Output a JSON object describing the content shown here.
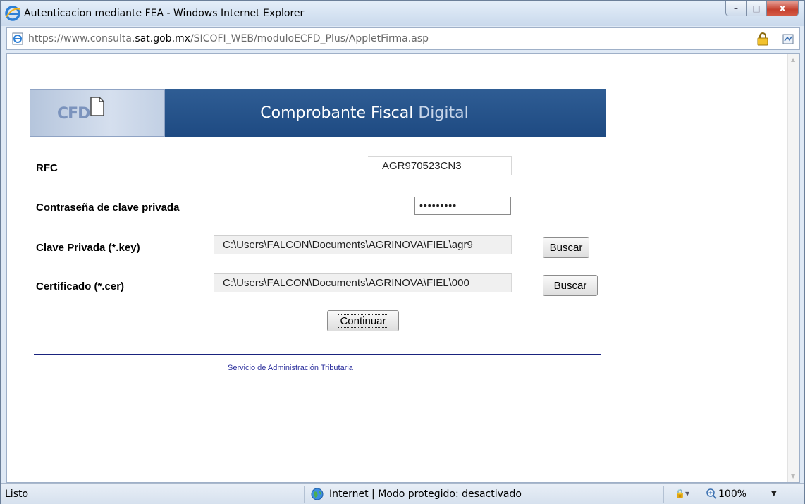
{
  "window": {
    "title": "Autenticacion mediante FEA - Windows Internet Explorer",
    "minimize_label": "–",
    "maximize_label": "□",
    "close_label": "x"
  },
  "address": {
    "url_scheme": "https://www.consulta.",
    "url_domain": "sat.gob.mx",
    "url_path": "/SICOFI_WEB/moduloECFD_Plus/AppletFirma.asp"
  },
  "banner": {
    "logo_text": "CFD",
    "title_main": "Comprobante Fiscal ",
    "title_accent": "Digital"
  },
  "form": {
    "rfc_label": "RFC",
    "rfc_value": "AGR970523CN3",
    "password_label": "Contraseña de clave privada",
    "password_value": "•••••••••",
    "key_label": "Clave Privada (*.key)",
    "key_value": "C:\\Users\\FALCON\\Documents\\AGRINOVA\\FIEL\\agr9",
    "key_button": "Buscar",
    "cert_label": "Certificado (*.cer)",
    "cert_value": "C:\\Users\\FALCON\\Documents\\AGRINOVA\\FIEL\\000",
    "cert_button": "Buscar",
    "continue_button": "Continuar"
  },
  "footer": {
    "text": "Servicio de Administración Tributaria"
  },
  "status": {
    "left_text": "Listo",
    "zone_text": "Internet | Modo protegido: desactivado",
    "zoom_text": "100%"
  },
  "colors": {
    "banner_blue": "#1e4a82",
    "rule_navy": "#1a237e",
    "footer_link": "#2b2f9c",
    "close_red": "#c5412f"
  },
  "icons": [
    "ie-logo-icon",
    "page-icon",
    "lock-icon",
    "compatibility-icon",
    "globe-icon",
    "zoom-icon",
    "document-icon"
  ]
}
